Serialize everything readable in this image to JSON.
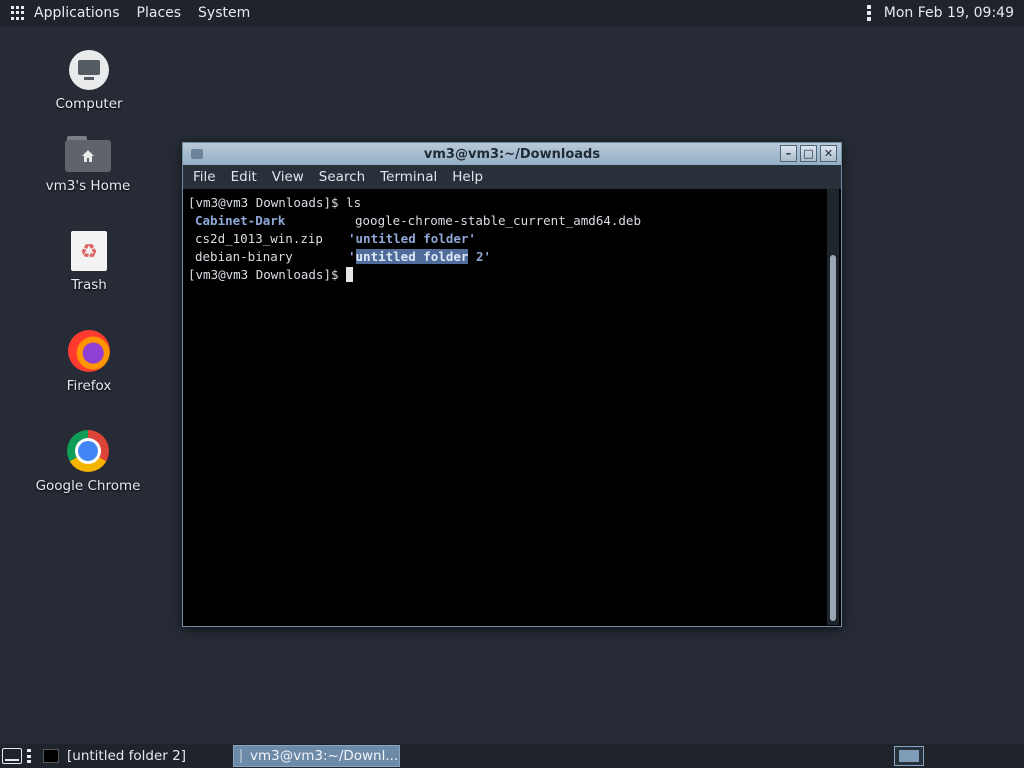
{
  "top_panel": {
    "menus": [
      "Applications",
      "Places",
      "System"
    ],
    "clock": "Mon Feb 19, 09:49"
  },
  "desktop": {
    "icons": [
      {
        "label": "Computer",
        "icon": "computer-icon"
      },
      {
        "label": "vm3's Home",
        "icon": "home-folder-icon"
      },
      {
        "label": "Trash",
        "icon": "trash-icon"
      },
      {
        "label": "Firefox",
        "icon": "firefox-icon"
      },
      {
        "label": "Google Chrome",
        "icon": "chrome-icon"
      }
    ]
  },
  "window": {
    "title": "vm3@vm3:~/Downloads",
    "menus": [
      "File",
      "Edit",
      "View",
      "Search",
      "Terminal",
      "Help"
    ]
  },
  "terminal": {
    "prompt": "[vm3@vm3 Downloads]$ ",
    "command": "ls",
    "entries": [
      {
        "name": "Cabinet-Dark",
        "type": "dir"
      },
      {
        "name": "google-chrome-stable_current_amd64.deb",
        "type": "file"
      },
      {
        "name": "cs2d_1013_win.zip",
        "type": "file"
      },
      {
        "name": "'untitled folder'",
        "type": "dir"
      },
      {
        "name": "debian-binary",
        "type": "file"
      },
      {
        "name": "'untitled folder 2'",
        "type": "dir"
      }
    ],
    "selected_text": "untitled folder"
  },
  "bottom_panel": {
    "tasks": [
      "[untitled folder 2]",
      "vm3@vm3:~/Downl..."
    ]
  },
  "colors": {
    "desktop": "#262b35",
    "titlebar": "#95aec5",
    "directory": "#8fa8d8",
    "selection": "#4f6c9b"
  }
}
